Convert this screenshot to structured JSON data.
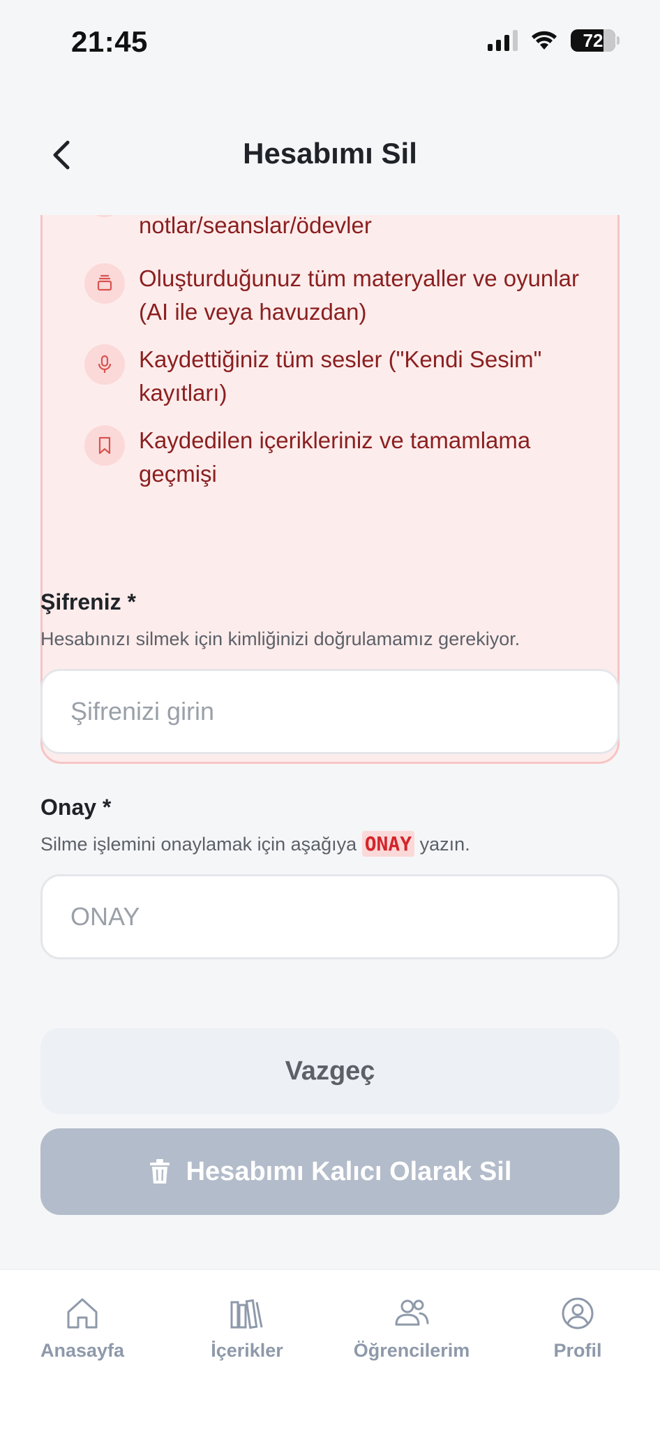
{
  "status_bar": {
    "time": "21:45",
    "battery": "72"
  },
  "header": {
    "title": "Hesabımı Sil"
  },
  "warning_items": [
    {
      "icon": "students-icon",
      "text": "Oluşturduğunuz tüm öğrenciler ve onlara ait notlar/seanslar/ödevler"
    },
    {
      "icon": "layers-icon",
      "text": "Oluşturduğunuz tüm materyaller ve oyunlar (AI ile veya havuzdan)"
    },
    {
      "icon": "microphone-icon",
      "text": "Kaydettiğiniz tüm sesler (\"Kendi Sesim\" kayıtları)"
    },
    {
      "icon": "bookmark-icon",
      "text": "Kaydedilen içerikleriniz ve tamamlama geçmişi"
    }
  ],
  "password": {
    "label": "Şifreniz *",
    "help": "Hesabınızı silmek için kimliğinizi doğrulamamız gerekiyor.",
    "placeholder": "Şifrenizi girin",
    "value": ""
  },
  "confirm": {
    "label": "Onay *",
    "help_before": "Silme işlemini onaylamak için aşağıya",
    "code": "ONAY",
    "help_after": "yazın.",
    "placeholder": "ONAY",
    "value": ""
  },
  "buttons": {
    "cancel": "Vazgeç",
    "delete": "Hesabımı Kalıcı Olarak Sil"
  },
  "tabs": [
    {
      "label": "Anasayfa",
      "icon": "home-icon"
    },
    {
      "label": "İçerikler",
      "icon": "library-icon"
    },
    {
      "label": "Öğrencilerim",
      "icon": "users-icon"
    },
    {
      "label": "Profil",
      "icon": "profile-icon"
    }
  ],
  "colors": {
    "warning_bg": "#fdecec",
    "warning_border": "#f7c4c4",
    "warning_text": "#8a1f1f",
    "delete_disabled": "#b3bcca",
    "tab_inactive": "#8e99aa"
  }
}
